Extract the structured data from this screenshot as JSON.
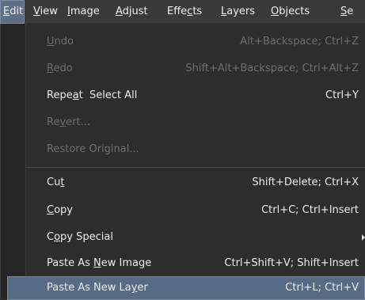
{
  "menubar": {
    "items": [
      {
        "pre": "",
        "u": "E",
        "post": "dit"
      },
      {
        "pre": "",
        "u": "V",
        "post": "iew"
      },
      {
        "pre": "",
        "u": "I",
        "post": "mage"
      },
      {
        "pre": "",
        "u": "A",
        "post": "djust"
      },
      {
        "pre": "Effe",
        "u": "c",
        "post": "ts"
      },
      {
        "pre": "",
        "u": "L",
        "post": "ayers"
      },
      {
        "pre": "",
        "u": "O",
        "post": "bjects"
      },
      {
        "pre": "",
        "u": "S",
        "post": "e"
      }
    ]
  },
  "menu": {
    "items": [
      {
        "pre": "",
        "u": "U",
        "post": "ndo",
        "shortcut": "Alt+Backspace; Ctrl+Z",
        "enabled": false
      },
      {
        "pre": "",
        "u": "R",
        "post": "edo",
        "shortcut": "Shift+Alt+Backspace; Ctrl+Alt+Z",
        "enabled": false
      },
      {
        "pre": "Repe",
        "u": "a",
        "post": "t  Select All",
        "shortcut": "Ctrl+Y",
        "enabled": true
      },
      {
        "pre": "Re",
        "u": "v",
        "post": "ert...",
        "shortcut": "",
        "enabled": false
      },
      {
        "pre": "Restore Original...",
        "u": "",
        "post": "",
        "shortcut": "",
        "enabled": false
      },
      {
        "pre": "Cu",
        "u": "t",
        "post": "",
        "shortcut": "Shift+Delete; Ctrl+X",
        "enabled": true
      },
      {
        "pre": "",
        "u": "C",
        "post": "opy",
        "shortcut": "Ctrl+C; Ctrl+Insert",
        "enabled": true
      },
      {
        "pre": "C",
        "u": "o",
        "post": "py Special",
        "shortcut": "",
        "enabled": true
      },
      {
        "pre": "Paste As ",
        "u": "N",
        "post": "ew Image",
        "shortcut": "Ctrl+Shift+V; Shift+Insert",
        "enabled": true
      },
      {
        "pre": "Paste As New La",
        "u": "y",
        "post": "er",
        "shortcut": "Ctrl+L; Ctrl+V",
        "enabled": true
      }
    ]
  }
}
